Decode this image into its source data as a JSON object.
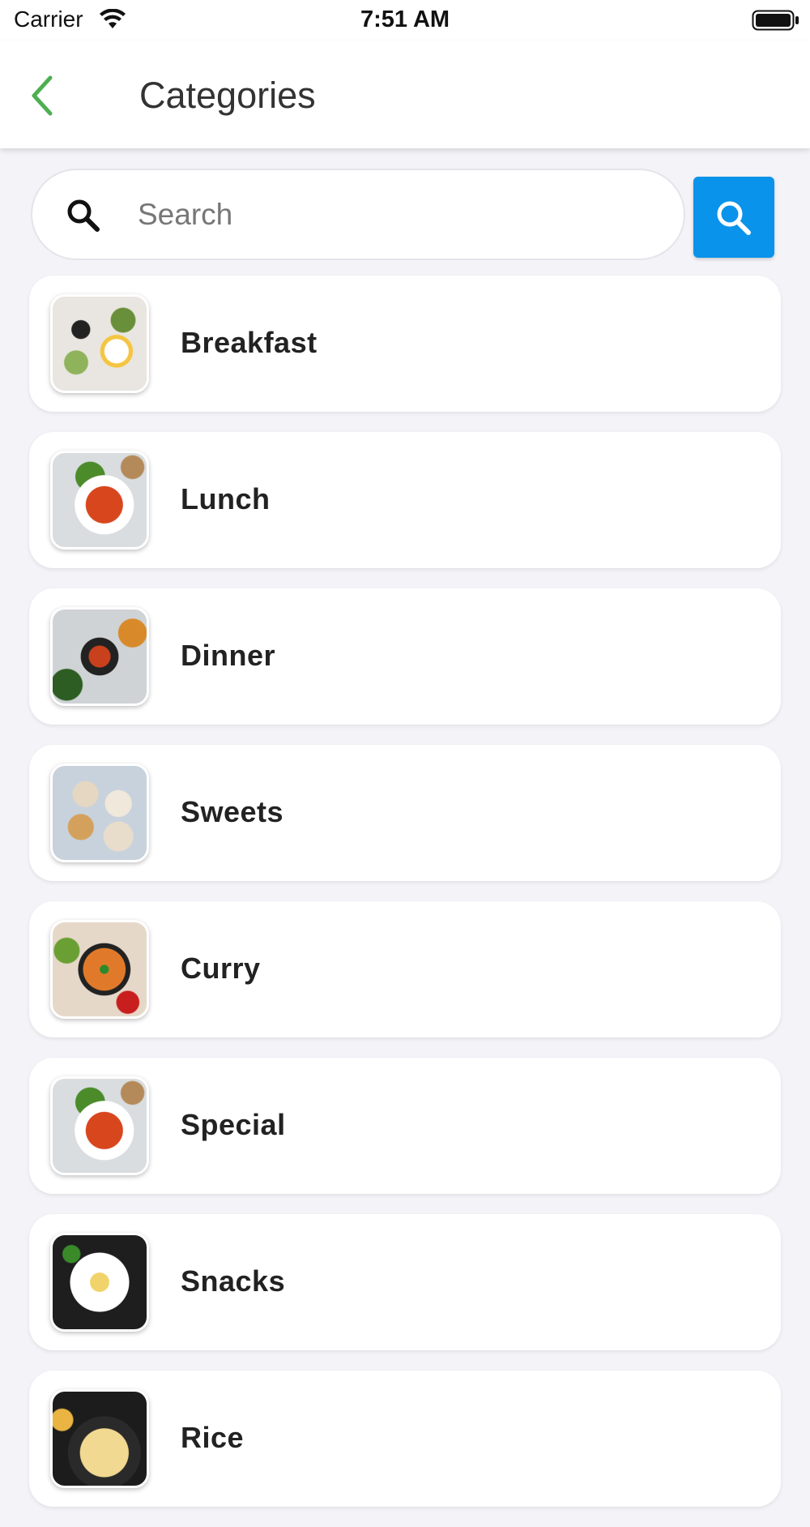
{
  "status_bar": {
    "carrier": "Carrier",
    "time": "7:51 AM"
  },
  "header": {
    "title": "Categories",
    "back_icon": "chevron-left-icon",
    "accent_color": "#4caf50"
  },
  "search": {
    "placeholder": "Search",
    "value": "",
    "button_icon": "search-icon",
    "button_color": "#0a93ea"
  },
  "categories": [
    {
      "label": "Breakfast"
    },
    {
      "label": "Lunch"
    },
    {
      "label": "Dinner"
    },
    {
      "label": "Sweets"
    },
    {
      "label": "Curry"
    },
    {
      "label": "Special"
    },
    {
      "label": "Snacks"
    },
    {
      "label": "Rice"
    }
  ]
}
